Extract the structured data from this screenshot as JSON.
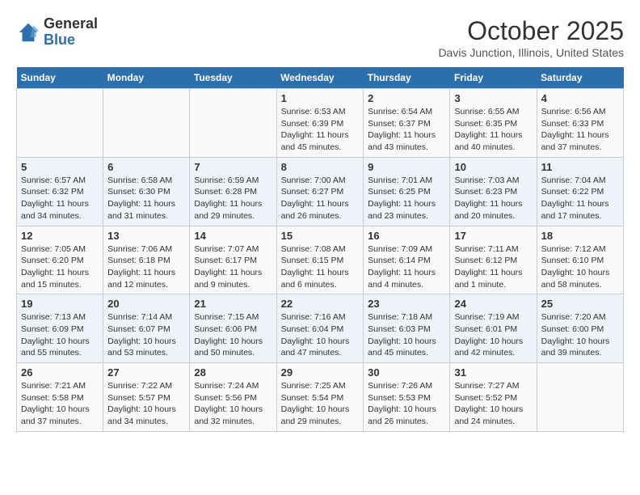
{
  "header": {
    "logo_general": "General",
    "logo_blue": "Blue",
    "month_title": "October 2025",
    "location": "Davis Junction, Illinois, United States"
  },
  "weekdays": [
    "Sunday",
    "Monday",
    "Tuesday",
    "Wednesday",
    "Thursday",
    "Friday",
    "Saturday"
  ],
  "weeks": [
    [
      {
        "day": "",
        "text": ""
      },
      {
        "day": "",
        "text": ""
      },
      {
        "day": "",
        "text": ""
      },
      {
        "day": "1",
        "text": "Sunrise: 6:53 AM\nSunset: 6:39 PM\nDaylight: 11 hours and 45 minutes."
      },
      {
        "day": "2",
        "text": "Sunrise: 6:54 AM\nSunset: 6:37 PM\nDaylight: 11 hours and 43 minutes."
      },
      {
        "day": "3",
        "text": "Sunrise: 6:55 AM\nSunset: 6:35 PM\nDaylight: 11 hours and 40 minutes."
      },
      {
        "day": "4",
        "text": "Sunrise: 6:56 AM\nSunset: 6:33 PM\nDaylight: 11 hours and 37 minutes."
      }
    ],
    [
      {
        "day": "5",
        "text": "Sunrise: 6:57 AM\nSunset: 6:32 PM\nDaylight: 11 hours and 34 minutes."
      },
      {
        "day": "6",
        "text": "Sunrise: 6:58 AM\nSunset: 6:30 PM\nDaylight: 11 hours and 31 minutes."
      },
      {
        "day": "7",
        "text": "Sunrise: 6:59 AM\nSunset: 6:28 PM\nDaylight: 11 hours and 29 minutes."
      },
      {
        "day": "8",
        "text": "Sunrise: 7:00 AM\nSunset: 6:27 PM\nDaylight: 11 hours and 26 minutes."
      },
      {
        "day": "9",
        "text": "Sunrise: 7:01 AM\nSunset: 6:25 PM\nDaylight: 11 hours and 23 minutes."
      },
      {
        "day": "10",
        "text": "Sunrise: 7:03 AM\nSunset: 6:23 PM\nDaylight: 11 hours and 20 minutes."
      },
      {
        "day": "11",
        "text": "Sunrise: 7:04 AM\nSunset: 6:22 PM\nDaylight: 11 hours and 17 minutes."
      }
    ],
    [
      {
        "day": "12",
        "text": "Sunrise: 7:05 AM\nSunset: 6:20 PM\nDaylight: 11 hours and 15 minutes."
      },
      {
        "day": "13",
        "text": "Sunrise: 7:06 AM\nSunset: 6:18 PM\nDaylight: 11 hours and 12 minutes."
      },
      {
        "day": "14",
        "text": "Sunrise: 7:07 AM\nSunset: 6:17 PM\nDaylight: 11 hours and 9 minutes."
      },
      {
        "day": "15",
        "text": "Sunrise: 7:08 AM\nSunset: 6:15 PM\nDaylight: 11 hours and 6 minutes."
      },
      {
        "day": "16",
        "text": "Sunrise: 7:09 AM\nSunset: 6:14 PM\nDaylight: 11 hours and 4 minutes."
      },
      {
        "day": "17",
        "text": "Sunrise: 7:11 AM\nSunset: 6:12 PM\nDaylight: 11 hours and 1 minute."
      },
      {
        "day": "18",
        "text": "Sunrise: 7:12 AM\nSunset: 6:10 PM\nDaylight: 10 hours and 58 minutes."
      }
    ],
    [
      {
        "day": "19",
        "text": "Sunrise: 7:13 AM\nSunset: 6:09 PM\nDaylight: 10 hours and 55 minutes."
      },
      {
        "day": "20",
        "text": "Sunrise: 7:14 AM\nSunset: 6:07 PM\nDaylight: 10 hours and 53 minutes."
      },
      {
        "day": "21",
        "text": "Sunrise: 7:15 AM\nSunset: 6:06 PM\nDaylight: 10 hours and 50 minutes."
      },
      {
        "day": "22",
        "text": "Sunrise: 7:16 AM\nSunset: 6:04 PM\nDaylight: 10 hours and 47 minutes."
      },
      {
        "day": "23",
        "text": "Sunrise: 7:18 AM\nSunset: 6:03 PM\nDaylight: 10 hours and 45 minutes."
      },
      {
        "day": "24",
        "text": "Sunrise: 7:19 AM\nSunset: 6:01 PM\nDaylight: 10 hours and 42 minutes."
      },
      {
        "day": "25",
        "text": "Sunrise: 7:20 AM\nSunset: 6:00 PM\nDaylight: 10 hours and 39 minutes."
      }
    ],
    [
      {
        "day": "26",
        "text": "Sunrise: 7:21 AM\nSunset: 5:58 PM\nDaylight: 10 hours and 37 minutes."
      },
      {
        "day": "27",
        "text": "Sunrise: 7:22 AM\nSunset: 5:57 PM\nDaylight: 10 hours and 34 minutes."
      },
      {
        "day": "28",
        "text": "Sunrise: 7:24 AM\nSunset: 5:56 PM\nDaylight: 10 hours and 32 minutes."
      },
      {
        "day": "29",
        "text": "Sunrise: 7:25 AM\nSunset: 5:54 PM\nDaylight: 10 hours and 29 minutes."
      },
      {
        "day": "30",
        "text": "Sunrise: 7:26 AM\nSunset: 5:53 PM\nDaylight: 10 hours and 26 minutes."
      },
      {
        "day": "31",
        "text": "Sunrise: 7:27 AM\nSunset: 5:52 PM\nDaylight: 10 hours and 24 minutes."
      },
      {
        "day": "",
        "text": ""
      }
    ]
  ]
}
